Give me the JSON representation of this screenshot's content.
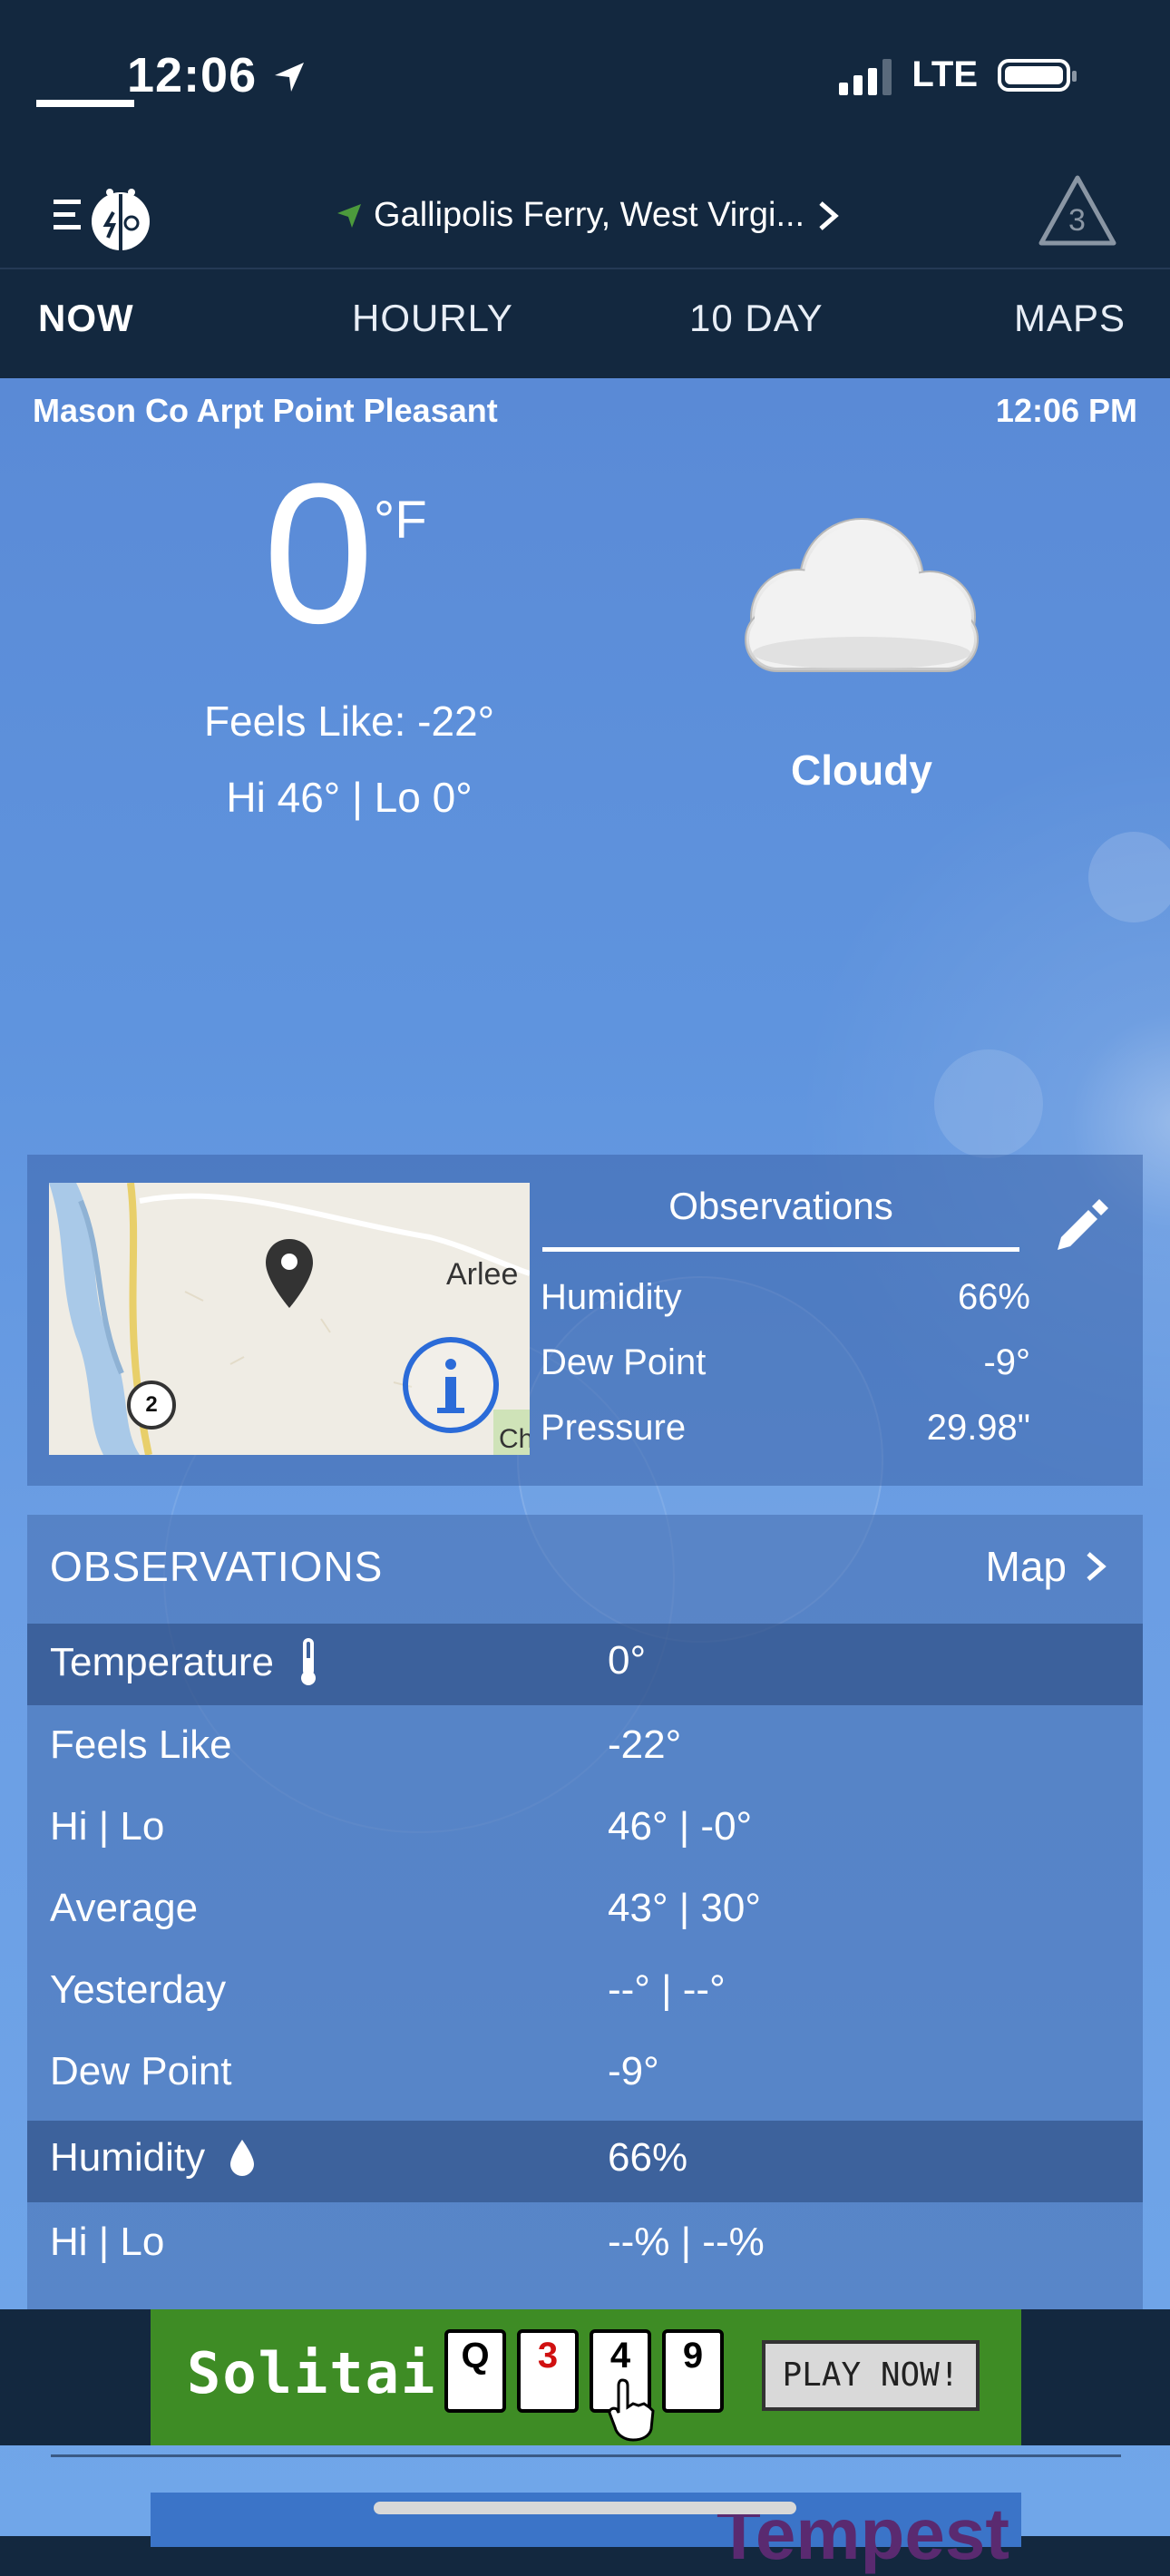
{
  "status": {
    "time": "12:06",
    "network": "LTE"
  },
  "header": {
    "location": "Gallipolis  Ferry,  West  Virgi...",
    "alert_count": "3"
  },
  "tabs": [
    "NOW",
    "HOURLY",
    "10  DAY",
    "MAPS"
  ],
  "current": {
    "station": "Mason Co Arpt Point Pleasant",
    "time": "12:06 PM",
    "temperature": "0",
    "unit": "°F",
    "feels_like": "Feels Like: -22°",
    "hi_lo": "Hi 46° | Lo 0°",
    "condition": "Cloudy",
    "condition_icon": "cloud-icon"
  },
  "map_thumb": {
    "place": "Arlee",
    "partial": "Ch",
    "route_badge": "2"
  },
  "obs_card": {
    "title": "Observations",
    "rows": [
      {
        "label": "Humidity",
        "value": "66%"
      },
      {
        "label": "Dew Point",
        "value": "-9°"
      },
      {
        "label": "Pressure",
        "value": "29.98\""
      }
    ]
  },
  "observations": {
    "title": "OBSERVATIONS",
    "map_link": "Map",
    "rows": [
      {
        "label": "Temperature",
        "value": "0°",
        "icon": "thermometer-icon"
      },
      {
        "label": "Feels Like",
        "value": "-22°"
      },
      {
        "label": "Hi | Lo",
        "value": "46° | -0°"
      },
      {
        "label": "Average",
        "value": "43° | 30°"
      },
      {
        "label": "Yesterday",
        "value": "--° | --°"
      },
      {
        "label": "Dew Point",
        "value": "-9°"
      },
      {
        "label": "Humidity",
        "value": "66%",
        "icon": "droplet-icon"
      },
      {
        "label": "Hi | Lo",
        "value": "--% | --%"
      }
    ]
  },
  "ad": {
    "title": "Solitaire",
    "cards": [
      "Q",
      "3",
      "4",
      "9"
    ],
    "cta": "PLAY NOW!",
    "ad2_text": "Tempest"
  },
  "colors": {
    "header_bg": "#13283f",
    "sky_top": "#5a8ad6",
    "ad_green": "#3e8c25"
  }
}
